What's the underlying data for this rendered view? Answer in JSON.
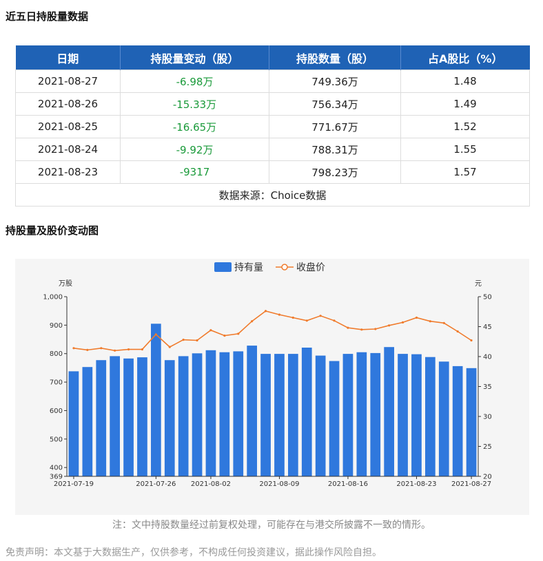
{
  "section1_title": "近五日持股量数据",
  "table": {
    "headers": [
      "日期",
      "持股量变动（股）",
      "持股数量（股）",
      "占A股比（%）"
    ],
    "rows": [
      [
        "2021-08-27",
        "-6.98万",
        "749.36万",
        "1.48"
      ],
      [
        "2021-08-26",
        "-15.33万",
        "756.34万",
        "1.49"
      ],
      [
        "2021-08-25",
        "-16.65万",
        "771.67万",
        "1.52"
      ],
      [
        "2021-08-24",
        "-9.92万",
        "788.31万",
        "1.55"
      ],
      [
        "2021-08-23",
        "-9317",
        "798.23万",
        "1.57"
      ]
    ],
    "source": "数据来源：Choice数据"
  },
  "section2_title": "持股量及股价变动图",
  "colors": {
    "bar": "#2f78dd",
    "line": "#f07b2c",
    "header": "#1f62b5",
    "change": "#1a9a3a"
  },
  "chart_data": {
    "type": "bar",
    "legend": [
      "持有量",
      "收盘价"
    ],
    "legend_position": "top-center",
    "y_left_label": "万股",
    "y_right_label": "元",
    "y_left_range": [
      369,
      1000
    ],
    "y_left_ticks": [
      "369",
      "400",
      "500",
      "600",
      "700",
      "800",
      "900",
      "1,000"
    ],
    "y_right_range": [
      20,
      50
    ],
    "y_right_ticks": [
      "20",
      "25",
      "30",
      "35",
      "40",
      "45",
      "50"
    ],
    "x_tick_labels": [
      "2021-07-19",
      "2021-07-26",
      "2021-08-02",
      "2021-08-09",
      "2021-08-16",
      "2021-08-23",
      "2021-08-27"
    ],
    "x_tick_indices": [
      0,
      6,
      10,
      15,
      20,
      25,
      29
    ],
    "grid": false,
    "series": [
      {
        "name": "持有量",
        "type": "bar",
        "values": [
          738,
          753,
          777,
          791,
          783,
          787,
          905,
          777,
          791,
          801,
          812,
          805,
          808,
          828,
          799,
          799,
          799,
          821,
          793,
          774,
          799,
          805,
          802,
          823,
          799,
          798,
          788,
          772,
          756,
          749
        ]
      },
      {
        "name": "收盘价",
        "type": "line",
        "values": [
          41.4,
          41.1,
          41.4,
          41.0,
          41.2,
          41.2,
          43.7,
          41.6,
          42.8,
          42.7,
          44.4,
          43.5,
          43.8,
          45.9,
          47.6,
          47.0,
          46.5,
          46.0,
          46.8,
          46.0,
          44.8,
          44.5,
          44.6,
          45.2,
          45.7,
          46.5,
          45.9,
          45.6,
          44.2,
          42.7
        ]
      }
    ]
  },
  "note": "注：文中持股数量经过前复权处理，可能存在与港交所披露不一致的情形。",
  "disclaimer": "免责声明：本文基于大数据生产，仅供参考，不构成任何投资建议，据此操作风险自担。"
}
